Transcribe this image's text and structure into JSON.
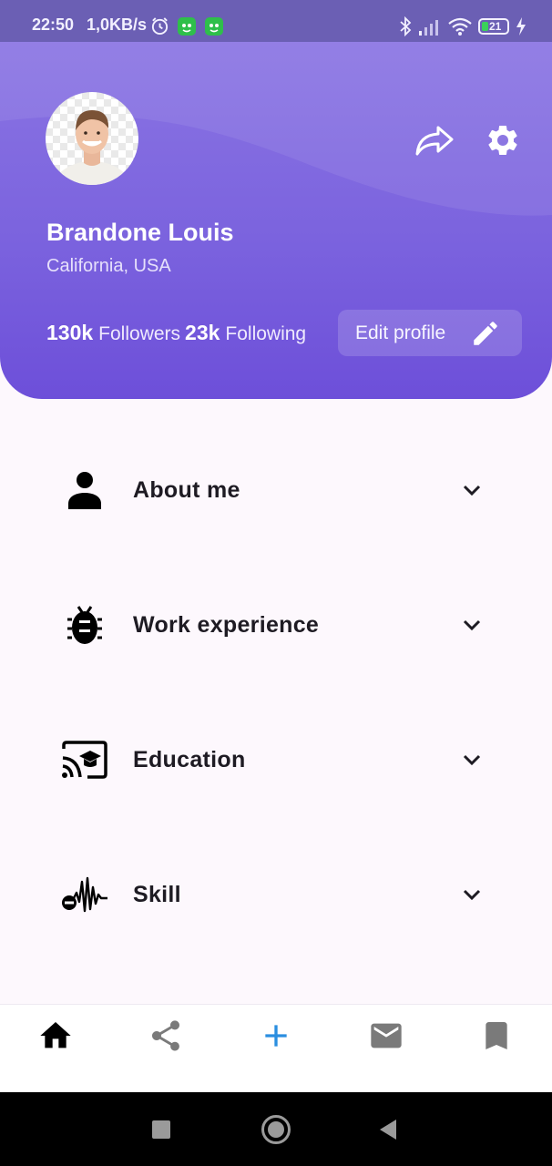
{
  "status_bar": {
    "time": "22:50",
    "net_speed": "1,0KB/s",
    "battery_level": "21",
    "icons": [
      "alarm-icon",
      "app-notification-icon",
      "app-notification-icon",
      "bluetooth-icon",
      "signal-icon",
      "wifi-icon",
      "battery-icon",
      "charging-icon"
    ]
  },
  "profile": {
    "name": "Brandone Louis",
    "location": "California, USA",
    "followers_count": "130k",
    "followers_label": "Followers",
    "following_count": "23k",
    "following_label": "Following",
    "edit_label": "Edit profile",
    "header_icons": [
      "share-icon",
      "settings-icon",
      "edit-icon"
    ]
  },
  "sections": [
    {
      "label": "About me",
      "icon": "person-icon"
    },
    {
      "label": "Work experience",
      "icon": "bug-icon"
    },
    {
      "label": "Education",
      "icon": "cast-for-education-icon"
    },
    {
      "label": "Skill",
      "icon": "audio-wave-icon"
    }
  ],
  "bottom_nav": {
    "items": [
      "home-icon",
      "share-icon",
      "add-icon",
      "mail-icon",
      "bookmark-icon"
    ],
    "active": "home-icon"
  },
  "system_nav": [
    "recents-icon",
    "home-icon",
    "back-icon"
  ],
  "colors": {
    "header_top": "#8a74e3",
    "header_bottom": "#6d4fd9",
    "status_bar": "#6b5fb4",
    "background": "#fdf8fd",
    "add_accent": "#2a8ee0"
  }
}
